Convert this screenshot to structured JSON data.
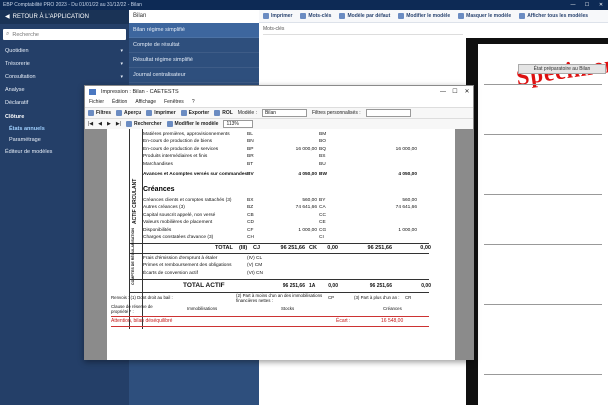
{
  "app": {
    "title": "EBP Comptabilité PRO 2023 - Du 01/01/22 au 31/12/22 - Bilan",
    "win_minimize": "—",
    "win_maximize": "☐",
    "win_close": "✕"
  },
  "sidebar": {
    "back_label": "RETOUR À L'APPLICATION",
    "search_placeholder": "Recherche",
    "items": [
      {
        "label": "Quotidien",
        "chev": "▾"
      },
      {
        "label": "Trésorerie",
        "chev": "▾"
      },
      {
        "label": "Consultation",
        "chev": "▾"
      },
      {
        "label": "Analyse",
        "chev": "▾"
      },
      {
        "label": "Déclaratif",
        "chev": "▾"
      },
      {
        "label": "Clôture",
        "chev": "▴"
      },
      {
        "label": "États annuels"
      },
      {
        "label": "Paramétrage"
      },
      {
        "label": "Éditeur de modèles"
      }
    ]
  },
  "midpane": {
    "header": "Bilan",
    "items": [
      "Bilan régime simplifié",
      "Compte de résultat",
      "Résultat régime simplifié",
      "Journal centralisateur"
    ]
  },
  "content_toolbar": {
    "print": "Imprimer",
    "keywords": "Mots-clés",
    "default_model": "Modèle par défaut",
    "modify_model": "Modifier le modèle",
    "hide_model": "Masquer le modèle",
    "show_all": "Afficher tous les modèles"
  },
  "keywords_label": "Mots-clés",
  "preview": {
    "watermark": "Specimen",
    "page_title": "État préparatoire au Bilan"
  },
  "dialog": {
    "title": "Impression : Bilan - CAETESTS",
    "dctl": {
      "min": "—",
      "max": "☐",
      "close": "✕"
    },
    "menu": [
      "Fichier",
      "Édition",
      "Affichage",
      "Fenêtres",
      "?"
    ],
    "tb1": {
      "filters": "Filtres",
      "preview": "Aperçu",
      "print": "Imprimer",
      "export": "Exporter",
      "rol": "ROL",
      "model_label": "Modèle :",
      "model_value": "Bilan",
      "custom_filters": "Filtres personnalisés :"
    },
    "tb2": {
      "search": "Rechercher",
      "modify": "Modifier le modèle",
      "zoom": "113%"
    }
  },
  "sheet": {
    "section_vertical": "ACTIF CIRCULANT",
    "section_vertical2": "COMPTES DE RÉGULARISATION",
    "creances_header": "Créances",
    "total_actif": "TOTAL ACTIF",
    "total_label": "TOTAL",
    "total_codes": {
      "c1": "(III)",
      "c2": "CJ",
      "v1": "96 251,66",
      "c3": "CK",
      "v2": "0,00",
      "v3": "96 251,66",
      "c4": "0,00"
    },
    "grand_totals": {
      "v1": "96 251,66",
      "c1": "1A",
      "v2": "0,00",
      "v3": "96 251,66",
      "v4": "0,00"
    },
    "rows": [
      {
        "label": "Matières premières, approvisionnements",
        "c1": "BL",
        "v1": "",
        "c2": "BM",
        "v2": ""
      },
      {
        "label": "En-cours de production de biens",
        "c1": "BN",
        "v1": "",
        "c2": "BO",
        "v2": ""
      },
      {
        "label": "En-cours de production de services",
        "c1": "BP",
        "v1": "16 000,00",
        "c2": "BQ",
        "v2": "16 000,00"
      },
      {
        "label": "Produits intermédiaires et finis",
        "c1": "BR",
        "v1": "",
        "c2": "BS",
        "v2": ""
      },
      {
        "label": "Marchandises",
        "c1": "BT",
        "v1": "",
        "c2": "BU",
        "v2": ""
      },
      {
        "label": "Avances et Acomptes versés sur commandes",
        "c1": "BV",
        "v1": "4 050,00",
        "c2": "BW",
        "v2": "4 050,00",
        "bold": true
      },
      {
        "label": "Créances clients et comptes rattachés (3)",
        "c1": "BX",
        "v1": "560,00",
        "c2": "BY",
        "v2": "560,00"
      },
      {
        "label": "Autres créances (3)",
        "c1": "BZ",
        "v1": "74 641,66",
        "c2": "CA",
        "v2": "74 641,66"
      },
      {
        "label": "Capital souscrit appelé, non versé",
        "c1": "CB",
        "v1": "",
        "c2": "CC",
        "v2": ""
      },
      {
        "label": "Valeurs mobilières de placement",
        "c1": "CD",
        "v1": "",
        "c2": "CE",
        "v2": ""
      },
      {
        "label": "Disponibilités",
        "c1": "CF",
        "v1": "1 000,00",
        "c2": "CG",
        "v2": "1 000,00"
      },
      {
        "label": "Charges constatées d'avance (3)",
        "c1": "CH",
        "v1": "",
        "c2": "CI",
        "v2": ""
      }
    ],
    "reg_rows": [
      {
        "label": "Frais d'émission d'emprunt à étaler",
        "c1": "(IV) CL"
      },
      {
        "label": "Primes et remboursement des obligations",
        "c1": "(V) CM"
      },
      {
        "label": "Écarts de conversion actif",
        "c1": "(VI) CN"
      }
    ],
    "footer1": {
      "a": "Renvois : (1) Dont droit au bail :",
      "b": "(2) Part à moins d'un an des immobilisations financières nettes :",
      "c": "CP",
      "d": "(3) Part à plus d'un an :",
      "e": "CR"
    },
    "footer2": {
      "a": "Clause de réserve de propriété * :",
      "b": "Immobilisations",
      "c": "Stocks",
      "d": "Créances"
    },
    "alert": "Attention, bilan déséquilibré",
    "ecart_label": "Écart :",
    "ecart_value": "16 548,00"
  }
}
